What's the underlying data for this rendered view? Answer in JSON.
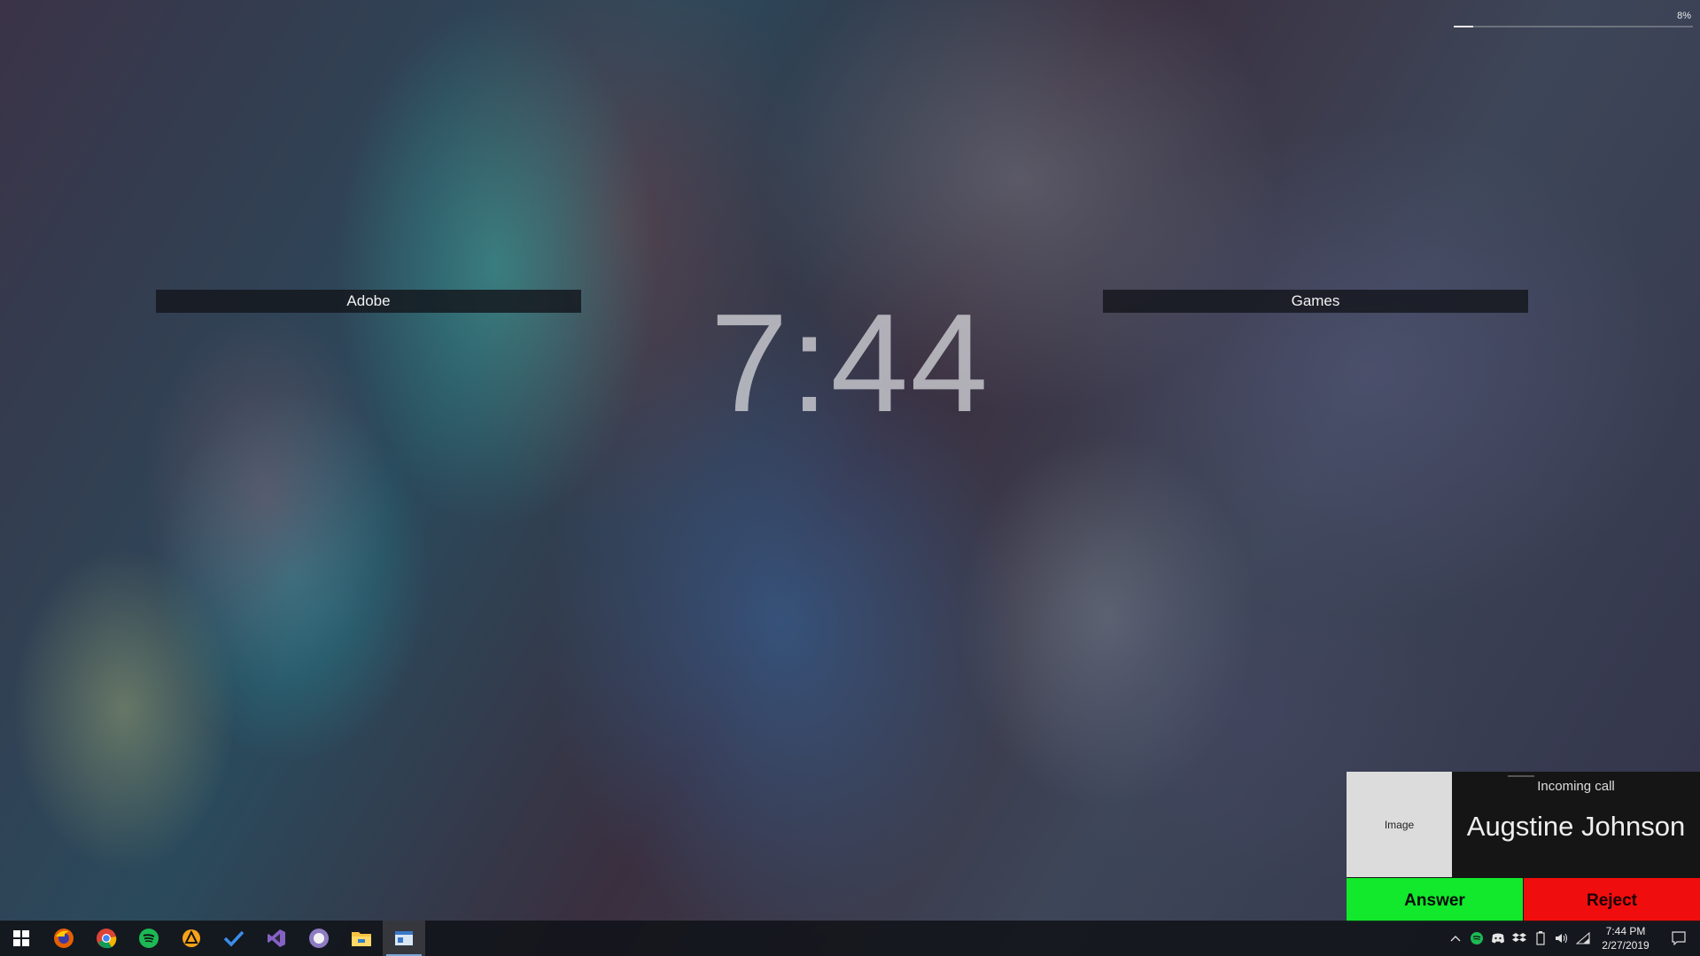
{
  "desktop": {
    "groups": [
      {
        "label": "Adobe"
      },
      {
        "label": "Games"
      }
    ],
    "clock": "7:44"
  },
  "progress": {
    "label": "8%",
    "value": 0.08
  },
  "call": {
    "title": "Incoming call",
    "image_label": "Image",
    "caller": "Augstine Johnson",
    "answer_label": "Answer",
    "reject_label": "Reject",
    "colors": {
      "answer": "#12e82c",
      "reject": "#f00d0d"
    }
  },
  "taskbar": {
    "apps": [
      {
        "icon": "windows-start-icon"
      },
      {
        "icon": "firefox-icon"
      },
      {
        "icon": "chrome-icon"
      },
      {
        "icon": "spotify-icon"
      },
      {
        "icon": "avast-icon"
      },
      {
        "icon": "todo-check-icon"
      },
      {
        "icon": "visual-studio-icon"
      },
      {
        "icon": "discord-like-icon"
      },
      {
        "icon": "file-explorer-icon"
      },
      {
        "icon": "app-window-icon",
        "active": true
      }
    ],
    "tray": {
      "icons": [
        "chevron-up-icon",
        "spotify-icon",
        "discord-icon",
        "dropbox-icon",
        "battery-icon",
        "volume-icon",
        "wifi-icon"
      ],
      "time": "7:44 PM",
      "date": "2/27/2019"
    }
  }
}
